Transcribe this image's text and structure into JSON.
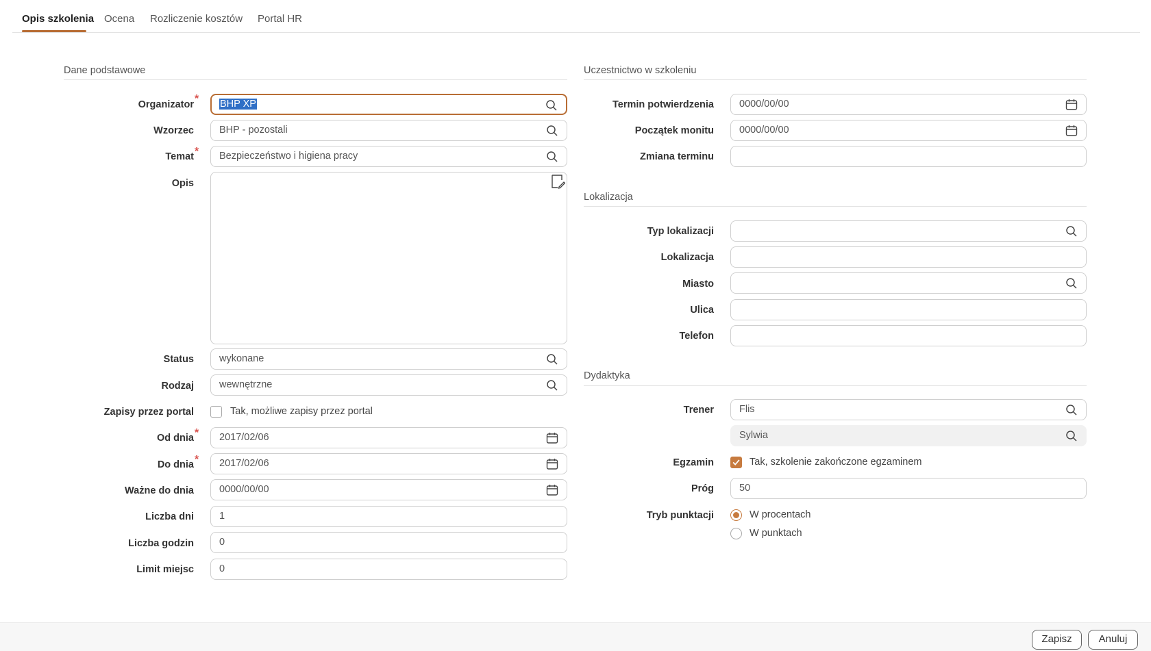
{
  "tabs": [
    "Opis szkolenia",
    "Ocena",
    "Rozliczenie kosztów",
    "Portal HR"
  ],
  "sections": {
    "basic": "Dane podstawowe",
    "participation": "Uczestnictwo w szkoleniu",
    "location": "Lokalizacja",
    "didactics": "Dydaktyka"
  },
  "basic": {
    "organizator": {
      "label": "Organizator",
      "value": "BHP XP"
    },
    "wzorzec": {
      "label": "Wzorzec",
      "value": "BHP - pozostali"
    },
    "temat": {
      "label": "Temat",
      "value": "Bezpieczeństwo i higiena pracy"
    },
    "opis": {
      "label": "Opis",
      "value": ""
    },
    "status": {
      "label": "Status",
      "value": "wykonane"
    },
    "rodzaj": {
      "label": "Rodzaj",
      "value": "wewnętrzne"
    },
    "zapisy": {
      "label": "Zapisy przez portal",
      "option": "Tak, możliwe zapisy przez portal",
      "checked": false
    },
    "od_dnia": {
      "label": "Od dnia",
      "value": "2017/02/06"
    },
    "do_dnia": {
      "label": "Do dnia",
      "value": "2017/02/06"
    },
    "wazne_do": {
      "label": "Ważne do dnia",
      "value": "0000/00/00"
    },
    "liczba_dni": {
      "label": "Liczba dni",
      "value": "1"
    },
    "liczba_godzin": {
      "label": "Liczba godzin",
      "value": "0"
    },
    "limit_miejsc": {
      "label": "Limit miejsc",
      "value": "0"
    }
  },
  "participation": {
    "termin": {
      "label": "Termin potwierdzenia",
      "value": "0000/00/00"
    },
    "poczatek": {
      "label": "Początek monitu",
      "value": "0000/00/00"
    },
    "zmiana": {
      "label": "Zmiana terminu",
      "value": ""
    }
  },
  "location": {
    "typ": {
      "label": "Typ lokalizacji",
      "value": ""
    },
    "lokalizacja": {
      "label": "Lokalizacja",
      "value": ""
    },
    "miasto": {
      "label": "Miasto",
      "value": ""
    },
    "ulica": {
      "label": "Ulica",
      "value": ""
    },
    "telefon": {
      "label": "Telefon",
      "value": ""
    }
  },
  "didactics": {
    "trener": {
      "label": "Trener",
      "value": "Flis",
      "value2": "Sylwia"
    },
    "egzamin": {
      "label": "Egzamin",
      "option": "Tak, szkolenie zakończone egzaminem",
      "checked": true
    },
    "prog": {
      "label": "Próg",
      "value": "50"
    },
    "tryb": {
      "label": "Tryb punktacji",
      "options": [
        "W procentach",
        "W punktach"
      ],
      "selected": "W procentach"
    }
  },
  "footer": {
    "save": "Zapisz",
    "cancel": "Anuluj"
  },
  "colors": {
    "accent": "#b86d34",
    "required": "#d9534f",
    "selection": "#2f6fc6"
  }
}
